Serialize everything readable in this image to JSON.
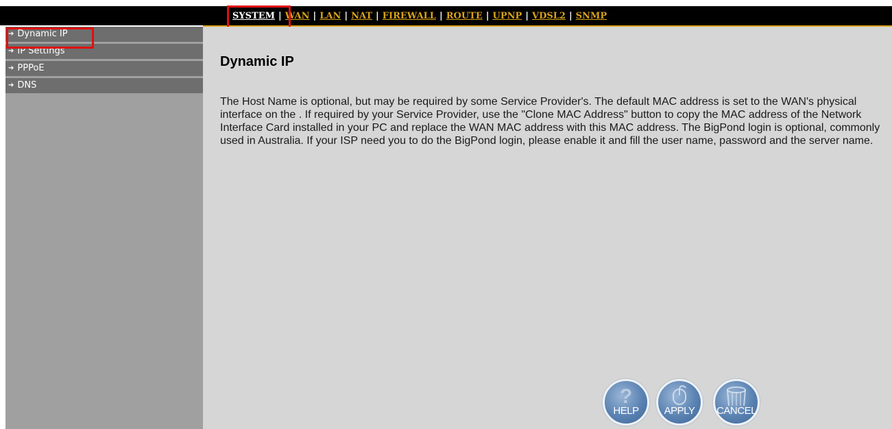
{
  "nav": {
    "items": [
      "SYSTEM",
      "WAN",
      "LAN",
      "NAT",
      "FIREWALL",
      "ROUTE",
      "UPNP",
      "VDSL2",
      "SNMP"
    ],
    "active": "SYSTEM",
    "separator": "|"
  },
  "sidebar": {
    "items": [
      {
        "label": "Dynamic IP"
      },
      {
        "label": "IP Settings"
      },
      {
        "label": "PPPoE"
      },
      {
        "label": "DNS"
      }
    ]
  },
  "main": {
    "title": "Dynamic IP",
    "description": "The Host Name is optional, but may be required by some Service Provider's. The default MAC address is set to the WAN's physical interface on the . If required by your Service Provider, use the \"Clone MAC Address\" button to copy the MAC address of the Network Interface Card installed in your PC and replace the WAN MAC address with this MAC address. The BigPond login is optional, commonly used in Australia. If your ISP need you to do the BigPond login, please enable it and fill the user name, password and the server name."
  },
  "buttons": {
    "help": "HELP",
    "apply": "APPLY",
    "cancel": "CANCEL"
  },
  "colors": {
    "nav_link": "#d8a21a",
    "highlight": "#e01010",
    "sidebar_item": "#6e6e6e",
    "content_bg": "#d6d6d6"
  },
  "icons": [
    "right-arrow-icon",
    "question-mark-icon",
    "mouse-icon",
    "trash-can-icon"
  ]
}
